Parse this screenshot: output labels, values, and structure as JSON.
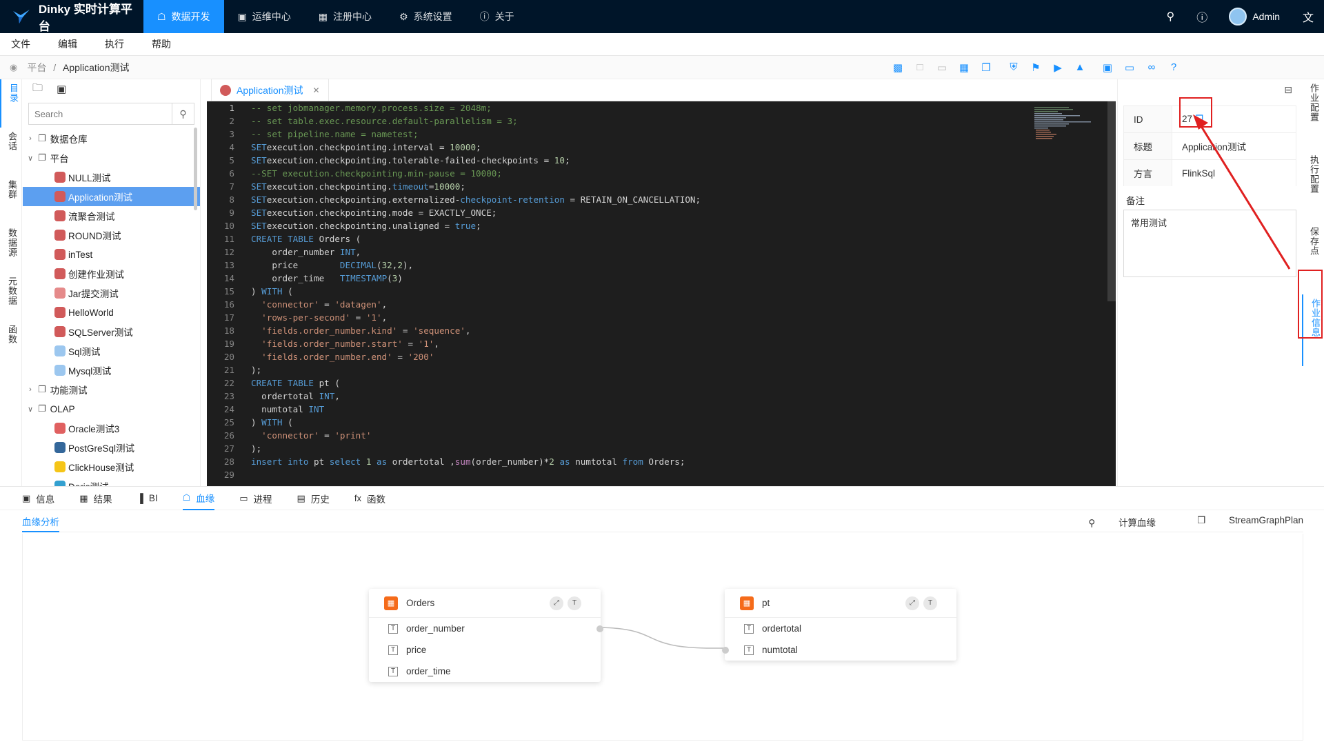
{
  "app": {
    "title": "Dinky 实时计算平台"
  },
  "nav": [
    {
      "label": "数据开发",
      "icon": "monitor-icon",
      "active": true
    },
    {
      "label": "运维中心",
      "icon": "ops-icon"
    },
    {
      "label": "注册中心",
      "icon": "grid-icon"
    },
    {
      "label": "系统设置",
      "icon": "gear-icon"
    },
    {
      "label": "关于",
      "icon": "info-icon"
    }
  ],
  "user": {
    "name": "Admin"
  },
  "menu": [
    "文件",
    "编辑",
    "执行",
    "帮助"
  ],
  "breadcrumb": {
    "root": "平台",
    "sep": "/",
    "current": "Application测试"
  },
  "left_tabs": [
    "目录",
    "会话",
    "集群",
    "数据源",
    "元数据",
    "函数"
  ],
  "search": {
    "placeholder": "Search"
  },
  "tree": [
    {
      "label": "数据仓库",
      "type": "folder",
      "level": 0,
      "expanded": false
    },
    {
      "label": "平台",
      "type": "folder",
      "level": 0,
      "expanded": true
    },
    {
      "label": "NULL测试",
      "type": "flink",
      "level": 1
    },
    {
      "label": "Application测试",
      "type": "flink",
      "level": 1,
      "selected": true
    },
    {
      "label": "流聚合测试",
      "type": "flink",
      "level": 1
    },
    {
      "label": "ROUND测试",
      "type": "flink",
      "level": 1
    },
    {
      "label": "inTest",
      "type": "flink",
      "level": 1
    },
    {
      "label": "创建作业测试",
      "type": "flink",
      "level": 1
    },
    {
      "label": "Jar提交测试",
      "type": "jar",
      "level": 1
    },
    {
      "label": "HelloWorld",
      "type": "flink",
      "level": 1
    },
    {
      "label": "SQLServer测试",
      "type": "flink",
      "level": 1
    },
    {
      "label": "Sql测试",
      "type": "sql",
      "level": 1
    },
    {
      "label": "Mysql测试",
      "type": "sql",
      "level": 1
    },
    {
      "label": "功能测试",
      "type": "folder",
      "level": 0,
      "expanded": false
    },
    {
      "label": "OLAP",
      "type": "folder",
      "level": 0,
      "expanded": true
    },
    {
      "label": "Oracle测试3",
      "type": "oracle",
      "level": 1
    },
    {
      "label": "PostGreSql测试",
      "type": "pg",
      "level": 1
    },
    {
      "label": "ClickHouse测试",
      "type": "ch",
      "level": 1
    },
    {
      "label": "Doris测试",
      "type": "doris",
      "level": 1
    }
  ],
  "editor": {
    "tab": "Application测试",
    "lines": [
      [
        [
          "c-com",
          "-- set jobmanager.memory.process.size = 2048m;"
        ]
      ],
      [
        [
          "c-com",
          "-- set table.exec.resource.default-parallelism = 3;"
        ]
      ],
      [
        [
          "c-com",
          "-- set pipeline.name = nametest;"
        ]
      ],
      [
        [
          "c-kw",
          "SET"
        ],
        [
          "",
          "execution.checkpointing.interval = "
        ],
        [
          "c-num",
          "10000"
        ],
        [
          "",
          ";"
        ]
      ],
      [
        [
          "c-kw",
          "SET"
        ],
        [
          "",
          "execution.checkpointing.tolerable-failed-checkpoints = "
        ],
        [
          "c-num",
          "10"
        ],
        [
          "",
          ";"
        ]
      ],
      [
        [
          "c-com",
          "--SET execution.checkpointing.min-pause = 10000;"
        ]
      ],
      [
        [
          "c-kw",
          "SET"
        ],
        [
          "",
          "execution.checkpointing."
        ],
        [
          "c-kw",
          "timeout"
        ],
        [
          "",
          ""
        ],
        [
          "",
          "="
        ],
        [
          "c-num",
          "10000"
        ],
        [
          "",
          ";"
        ]
      ],
      [
        [
          "c-kw",
          "SET"
        ],
        [
          "",
          "execution.checkpointing.externalized-"
        ],
        [
          "c-kw",
          "checkpoint-retention"
        ],
        [
          "",
          " = RETAIN_ON_CANCELLATION;"
        ]
      ],
      [
        [
          "c-kw",
          "SET"
        ],
        [
          "",
          "execution.checkpointing.mode = EXACTLY_ONCE;"
        ]
      ],
      [
        [
          "c-kw",
          "SET"
        ],
        [
          "",
          "execution.checkpointing.unaligned = "
        ],
        [
          "c-kw",
          "true"
        ],
        [
          "",
          ";"
        ]
      ],
      [
        [
          "c-kw",
          "CREATE TABLE"
        ],
        [
          "",
          " Orders ("
        ]
      ],
      [
        [
          "",
          "    order_number "
        ],
        [
          "c-kw",
          "INT"
        ],
        [
          "",
          ","
        ]
      ],
      [
        [
          "",
          "    price        "
        ],
        [
          "c-kw",
          "DECIMAL"
        ],
        [
          "",
          "("
        ],
        [
          "c-num",
          "32"
        ],
        [
          "",
          ","
        ],
        [
          "c-num",
          "2"
        ],
        [
          "",
          "),"
        ]
      ],
      [
        [
          "",
          "    order_time   "
        ],
        [
          "c-kw",
          "TIMESTAMP"
        ],
        [
          "",
          "("
        ],
        [
          "c-num",
          "3"
        ],
        [
          "",
          ")"
        ]
      ],
      [
        [
          "",
          ") "
        ],
        [
          "c-kw",
          "WITH"
        ],
        [
          "",
          " ("
        ]
      ],
      [
        [
          "",
          "  "
        ],
        [
          "c-str",
          "'connector'"
        ],
        [
          "",
          " = "
        ],
        [
          "c-str",
          "'datagen'"
        ],
        [
          "",
          ","
        ]
      ],
      [
        [
          "",
          "  "
        ],
        [
          "c-str",
          "'rows-per-second'"
        ],
        [
          "",
          " = "
        ],
        [
          "c-str",
          "'1'"
        ],
        [
          "",
          ","
        ]
      ],
      [
        [
          "",
          "  "
        ],
        [
          "c-str",
          "'fields.order_number.kind'"
        ],
        [
          "",
          " = "
        ],
        [
          "c-str",
          "'sequence'"
        ],
        [
          "",
          ","
        ]
      ],
      [
        [
          "",
          "  "
        ],
        [
          "c-str",
          "'fields.order_number.start'"
        ],
        [
          "",
          " = "
        ],
        [
          "c-str",
          "'1'"
        ],
        [
          "",
          ","
        ]
      ],
      [
        [
          "",
          "  "
        ],
        [
          "c-str",
          "'fields.order_number.end'"
        ],
        [
          "",
          " = "
        ],
        [
          "c-str",
          "'200'"
        ]
      ],
      [
        [
          "",
          ");"
        ]
      ],
      [
        [
          "c-kw",
          "CREATE TABLE"
        ],
        [
          "",
          " pt ("
        ]
      ],
      [
        [
          "",
          "  ordertotal "
        ],
        [
          "c-kw",
          "INT"
        ],
        [
          "",
          ","
        ]
      ],
      [
        [
          "",
          "  numtotal "
        ],
        [
          "c-kw",
          "INT"
        ]
      ],
      [
        [
          "",
          ") "
        ],
        [
          "c-kw",
          "WITH"
        ],
        [
          "",
          " ("
        ]
      ],
      [
        [
          "",
          "  "
        ],
        [
          "c-str",
          "'connector'"
        ],
        [
          "",
          " = "
        ],
        [
          "c-str",
          "'print'"
        ]
      ],
      [
        [
          "",
          ");"
        ]
      ],
      [
        [
          "c-kw",
          "insert into"
        ],
        [
          "",
          " pt "
        ],
        [
          "c-kw",
          "select"
        ],
        [
          "",
          " "
        ],
        [
          "c-num",
          "1"
        ],
        [
          "",
          " "
        ],
        [
          "c-kw",
          "as"
        ],
        [
          "",
          " ordertotal ,"
        ],
        [
          "c-pink",
          "sum"
        ],
        [
          "",
          "(order_number)*"
        ],
        [
          "c-num",
          "2"
        ],
        [
          "",
          " "
        ],
        [
          "c-kw",
          "as"
        ],
        [
          "",
          " numtotal "
        ],
        [
          "c-kw",
          "from"
        ],
        [
          "",
          " Orders;"
        ]
      ],
      []
    ]
  },
  "job_info": {
    "id_label": "ID",
    "id_value": "27",
    "title_label": "标题",
    "title_value": "Application测试",
    "dialect_label": "方言",
    "dialect_value": "FlinkSql",
    "note_label": "备注",
    "note_value": "常用测试"
  },
  "right_tabs": [
    "作业配置",
    "执行配置",
    "保存点",
    "作业信息"
  ],
  "bottom_tabs": [
    {
      "label": "信息",
      "icon": "terminal-icon"
    },
    {
      "label": "结果",
      "icon": "table-icon"
    },
    {
      "label": "BI",
      "icon": "bar-chart-icon"
    },
    {
      "label": "血缘",
      "icon": "lineage-icon",
      "active": true
    },
    {
      "label": "进程",
      "icon": "desktop-icon"
    },
    {
      "label": "历史",
      "icon": "calendar-icon"
    },
    {
      "label": "函数",
      "icon": "function-icon"
    }
  ],
  "lineage": {
    "subtab": "血缘分析",
    "compute": "计算血缘",
    "plan": "StreamGraphPlan",
    "tables": [
      {
        "name": "Orders",
        "columns": [
          "order_number",
          "price",
          "order_time"
        ]
      },
      {
        "name": "pt",
        "columns": [
          "ordertotal",
          "numtotal"
        ]
      }
    ]
  },
  "colors": {
    "accent": "#1890ff",
    "topbar": "#001529",
    "highlight": "#e02020"
  }
}
